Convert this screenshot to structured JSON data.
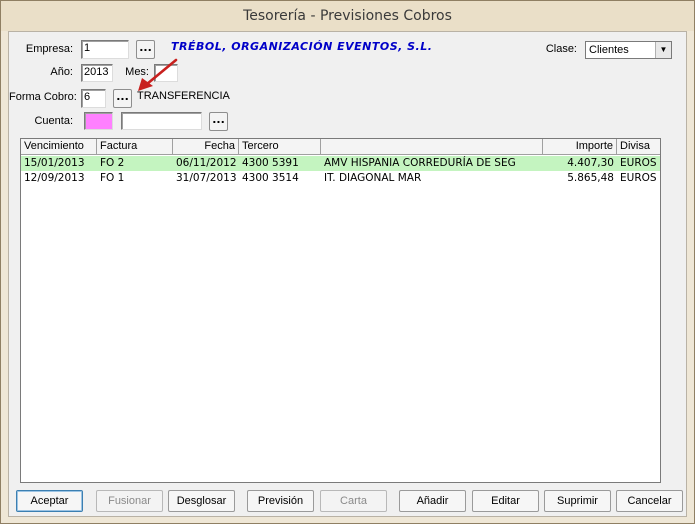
{
  "window": {
    "title": "Tesorería - Previsiones Cobros"
  },
  "form": {
    "empresa_label": "Empresa:",
    "empresa_value": "1",
    "empresa_name": "TRÉBOL, ORGANIZACIÓN EVENTOS, S.L.",
    "anio_label": "Año:",
    "anio_value": "2013",
    "mes_label": "Mes:",
    "mes_value": "",
    "forma_cobro_label": "Forma Cobro:",
    "forma_cobro_value": "6",
    "forma_cobro_name": "TRANSFERENCIA",
    "cuenta_label": "Cuenta:",
    "cuenta_value": "",
    "cuenta_desc": "",
    "clase_label": "Clase:",
    "clase_value": "Clientes",
    "dots_label": "...",
    "highlight_color": "#ff80ff"
  },
  "table": {
    "columns": [
      "Vencimiento",
      "Factura",
      "Fecha",
      "Tercero",
      "",
      "Importe",
      "Divisa"
    ],
    "rows": [
      [
        "15/01/2013",
        "FO 2",
        "06/11/2012",
        "4300 5391",
        "AMV HISPANIA CORREDURÍA DE SEG",
        "4.407,30",
        "EUROS"
      ],
      [
        "12/09/2013",
        "FO 1",
        "31/07/2013",
        "4300 3514",
        "IT. DIAGONAL MAR",
        "5.865,48",
        "EUROS"
      ]
    ],
    "selected_row_color": "#c4f4c0"
  },
  "buttons": {
    "aceptar": "Aceptar",
    "fusionar": "Fusionar",
    "desglosar": "Desglosar",
    "prevision": "Previsión",
    "carta": "Carta",
    "anadir": "Añadir",
    "editar": "Editar",
    "suprimir": "Suprimir",
    "cancelar": "Cancelar"
  },
  "icons": {
    "annotation": "red-arrow-icon"
  }
}
